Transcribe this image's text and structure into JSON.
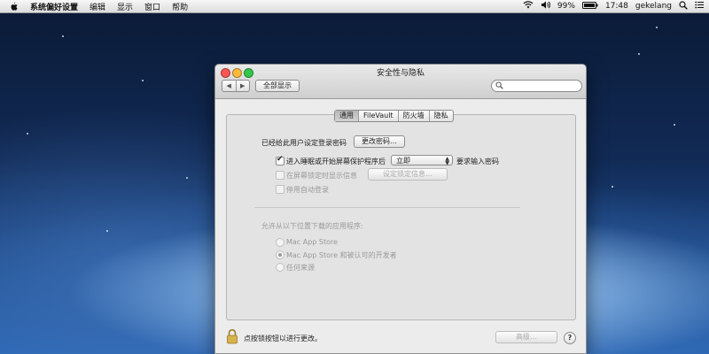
{
  "menubar": {
    "app_name": "系统偏好设置",
    "items": [
      "编辑",
      "显示",
      "窗口",
      "帮助"
    ],
    "battery": "99%",
    "time": "17:48",
    "user": "gekelang"
  },
  "window": {
    "title": "安全性与隐私",
    "show_all_label": "全部显示",
    "search_placeholder": "",
    "tabs": [
      "通用",
      "FileVault",
      "防火墙",
      "隐私"
    ],
    "active_tab": "通用"
  },
  "general": {
    "password_set_text": "已经给此用户设定登录密码",
    "change_password_button": "更改密码…",
    "require_password_checkbox": {
      "label": "进入睡眠或开始屏幕保护程序后",
      "checked": true
    },
    "require_password_delay": "立即",
    "require_password_suffix": "要求输入密码",
    "show_message_checkbox": {
      "label": "在屏幕锁定时显示信息",
      "checked": false
    },
    "set_lock_message_button": "设定锁定信息…",
    "disable_auto_login_checkbox": {
      "label": "停用自动登录",
      "checked": false
    },
    "download_section_title": "允许从以下位置下载的应用程序:",
    "download_options": [
      {
        "label": "Mac App Store",
        "selected": false
      },
      {
        "label": "Mac App Store 和被认可的开发者",
        "selected": true
      },
      {
        "label": "任何来源",
        "selected": false
      }
    ]
  },
  "footer": {
    "lock_text": "点按锁按钮以进行更改。",
    "advanced_button": "高级…",
    "help_label": "?"
  },
  "colors": {
    "close": "#fc5753",
    "minimize": "#fdbc40",
    "zoom": "#34c84a"
  }
}
